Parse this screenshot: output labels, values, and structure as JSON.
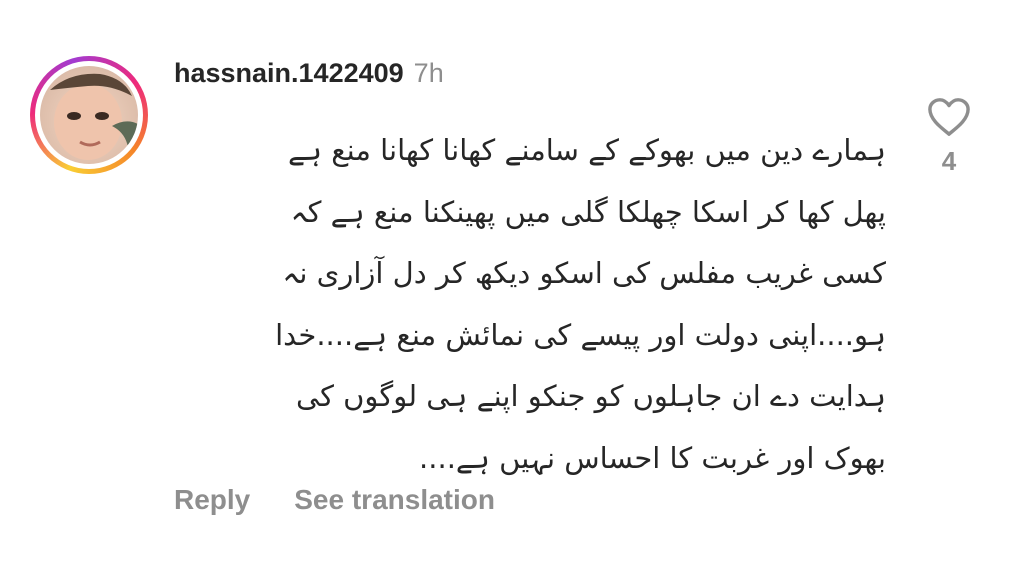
{
  "comment": {
    "username": "hassnain.1422409",
    "timestamp": "7h",
    "text_lines": [
      "ہمارے دین میں بھوکے کے سامنے کھانا کھانا منع ہے",
      "پھل کھا کر اسکا چھلکا گلی میں پھینکنا منع ہے کہ",
      "کسی غریب مفلس کی اسکو دیکھ کر  دل آزاری نہ",
      "ہو....اپنی دولت اور پیسے کی نمائش منع ہے....خدا",
      "ہدایت دے ان جاہلوں کو جنکو اپنے ہی لوگوں کی",
      "بھوک اور غربت کا احساس نہیں ہے...."
    ],
    "like_count": "4",
    "actions": {
      "reply": "Reply",
      "see_translation": "See translation"
    }
  },
  "icons": {
    "like": "heart-outline-icon",
    "avatar": "profile-photo"
  },
  "colors": {
    "text_primary": "#262626",
    "text_secondary": "#8e8e8e",
    "story_ring_start": "#f9ce34",
    "story_ring_mid": "#ee2a7b",
    "story_ring_end": "#a23bd1"
  }
}
